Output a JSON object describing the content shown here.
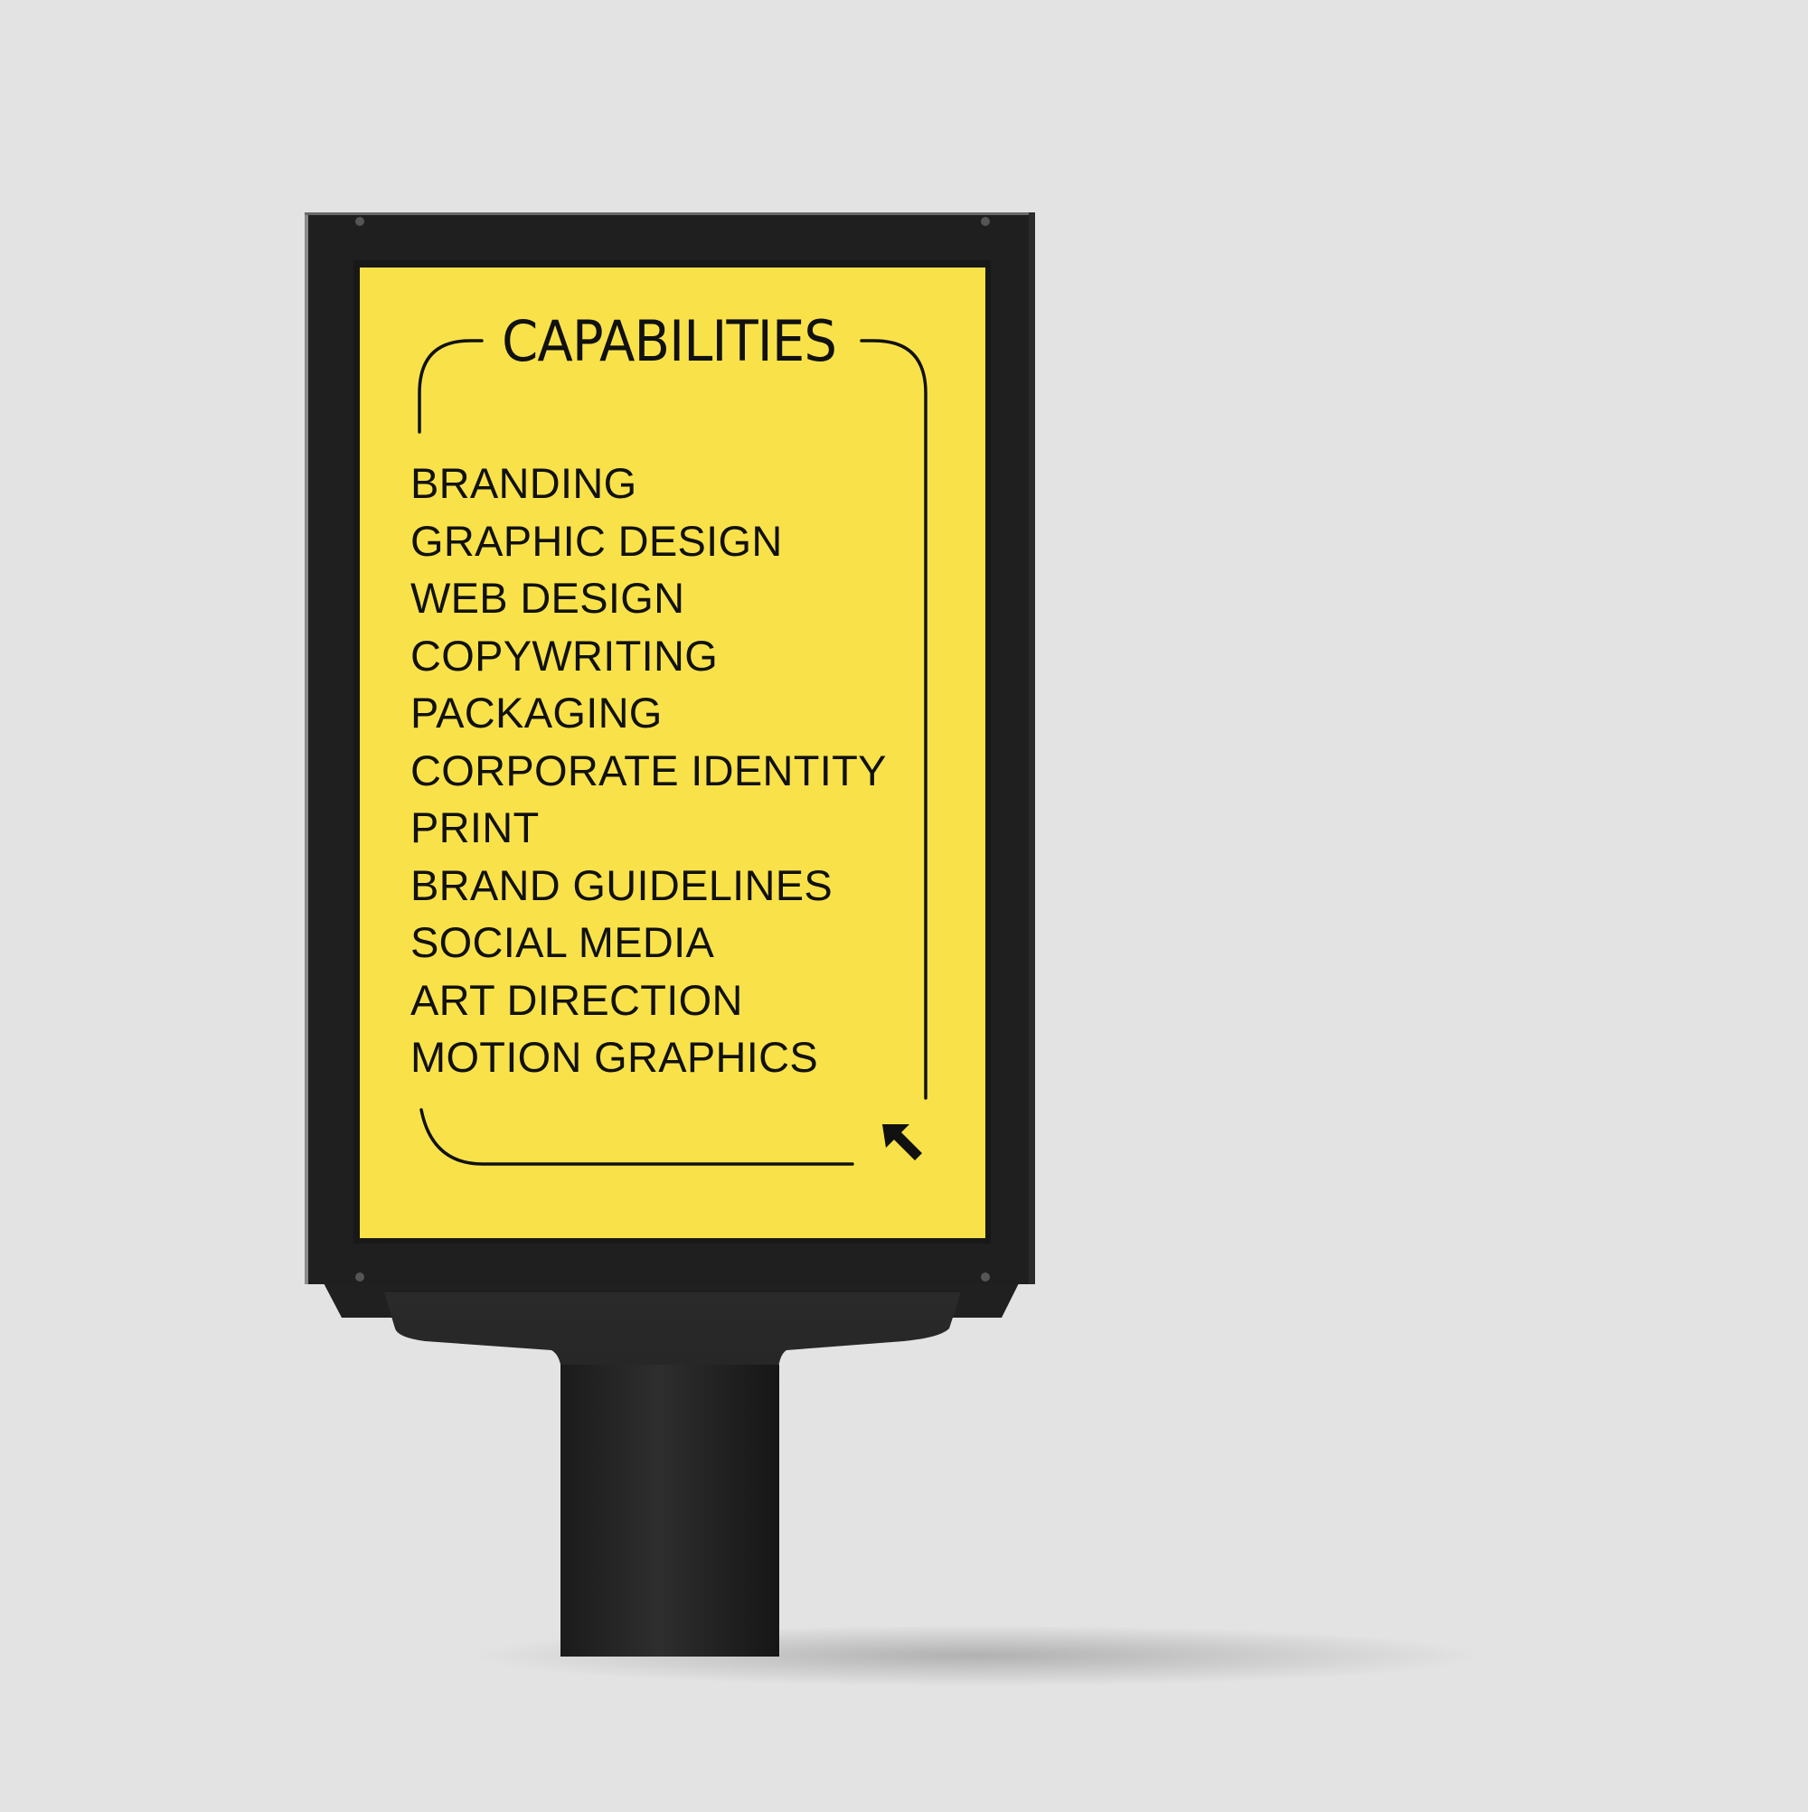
{
  "background_color": "#e3e3e3",
  "poster": {
    "color": "#f9e249",
    "frame_color": "#1f1f1f",
    "text_color": "#111111",
    "title": "CAPABILITIES",
    "items": [
      "BRANDING",
      "GRAPHIC DESIGN",
      "WEB DESIGN",
      "COPYWRITING",
      "PACKAGING",
      "CORPORATE IDENTITY",
      "PRINT",
      "BRAND GUIDELINES",
      "SOCIAL MEDIA",
      "ART DIRECTION",
      "MOTION GRAPHICS"
    ],
    "corner_icon": "arrow-up-left-icon"
  }
}
